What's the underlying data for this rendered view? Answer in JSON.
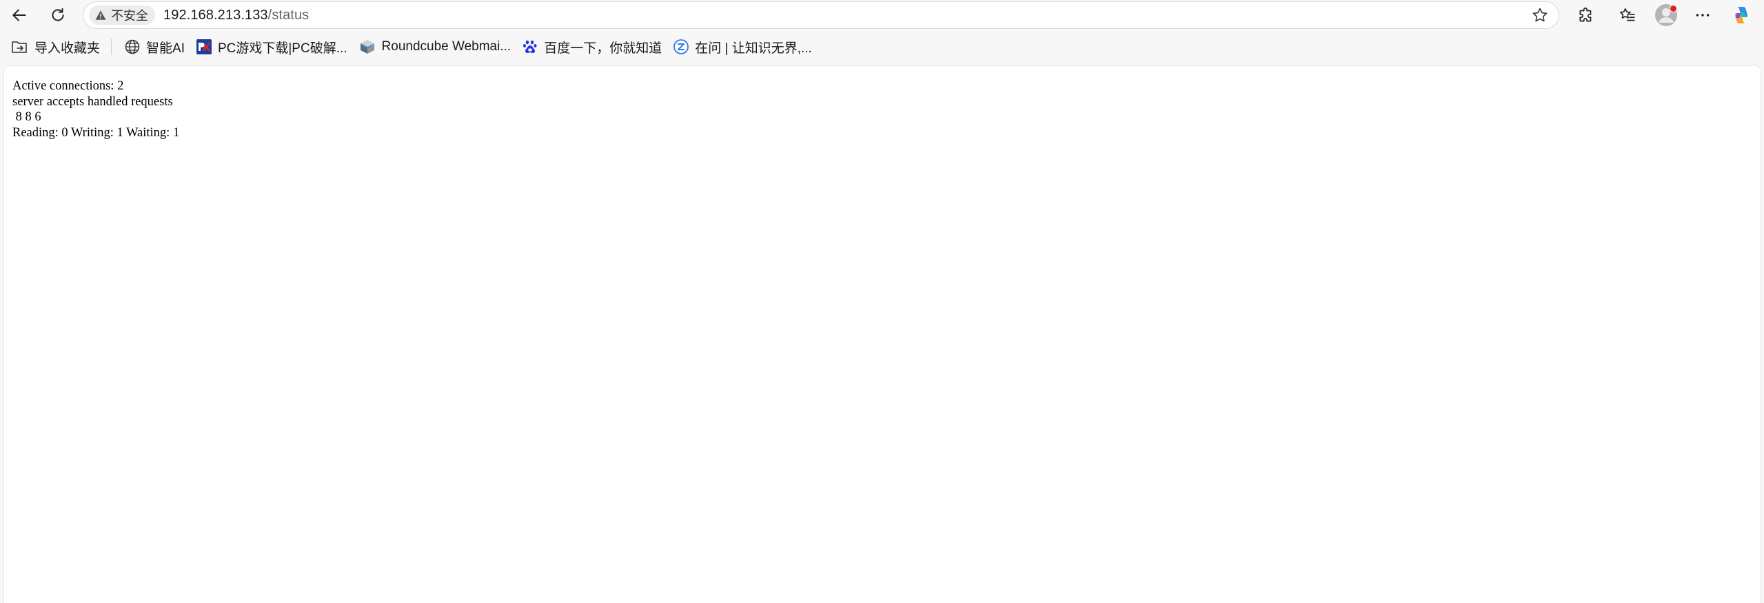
{
  "browser": {
    "security_label": "不安全",
    "url_host": "192.168.213.133",
    "url_path": "/status"
  },
  "bookmarks": [
    {
      "label": "导入收藏夹",
      "icon": "import-favorites-icon"
    },
    {
      "label": "智能AI",
      "icon": "globe-icon"
    },
    {
      "label": "PC游戏下载|PC破解...",
      "icon": "pc-game-site-icon"
    },
    {
      "label": "Roundcube Webmai...",
      "icon": "roundcube-icon"
    },
    {
      "label": "百度一下，你就知道",
      "icon": "baidu-paw-icon"
    },
    {
      "label": "在问 | 让知识无界,...",
      "icon": "zaiwen-icon"
    }
  ],
  "page": {
    "lines": [
      "Active connections: 2 ",
      "server accepts handled requests",
      " 8 8 6 ",
      "Reading: 0 Writing: 1 Waiting: 1 "
    ]
  },
  "colors": {
    "toolbar_bg": "#f7f7f7",
    "page_bg": "#ffffff",
    "notification_dot": "#e02020"
  }
}
